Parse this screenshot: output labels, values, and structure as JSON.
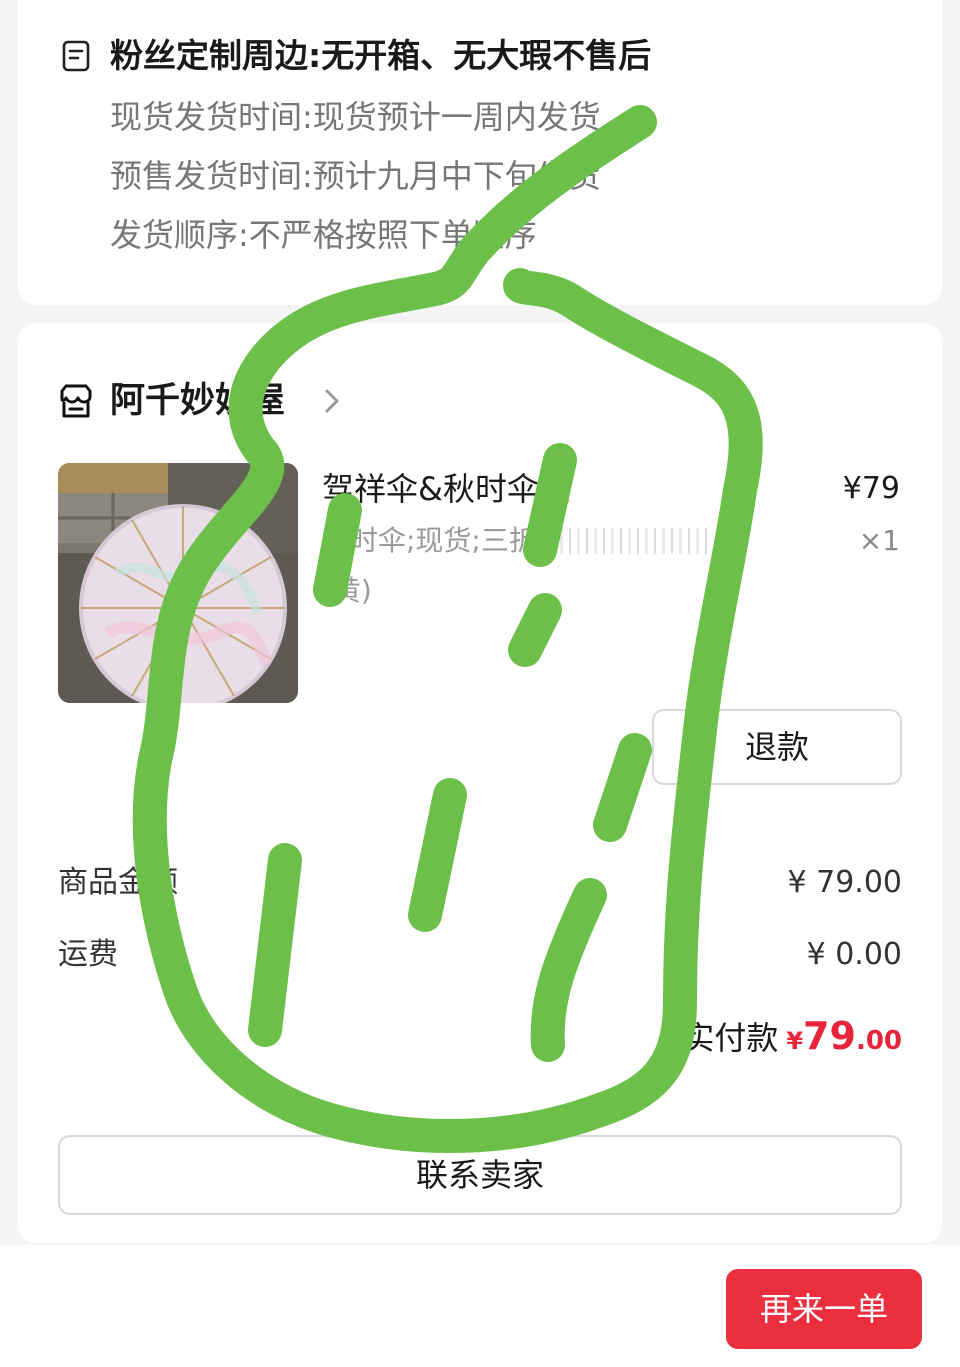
{
  "notice": {
    "title": "粉丝定制周边:无开箱、无大瑕不售后",
    "lines": [
      "现货发货时间:现货预计一周内发货",
      "预售发货时间:预计九月中下旬发货",
      "发货顺序:不严格按照下单顺序"
    ],
    "icon": "note-icon"
  },
  "store": {
    "name": "阿千妙妙屋",
    "icon": "store-icon",
    "chevron_icon": "chevron-right-icon"
  },
  "product": {
    "name": "驾祥伞&秋时伞",
    "emoji_icon": "umbrella-on-ground-icon",
    "spec_line1": "秋时伞;现货;三折",
    "spec_line2": "(黄)",
    "price": "¥79",
    "quantity": "×1"
  },
  "actions": {
    "refund_label": "退款",
    "contact_label": "联系卖家",
    "reorder_label": "再来一单"
  },
  "summary": {
    "goods_amount_label": "商品金额",
    "goods_amount_value": "¥ 79.00",
    "shipping_label": "运费",
    "shipping_value": "¥ 0.00",
    "paid_label": "实付款",
    "paid_currency": "¥",
    "paid_integer": "79",
    "paid_decimal": ".00"
  },
  "colors": {
    "accent_red": "#ec2f3f",
    "price_red": "#e8243a",
    "scribble_green": "#6cc04a"
  }
}
